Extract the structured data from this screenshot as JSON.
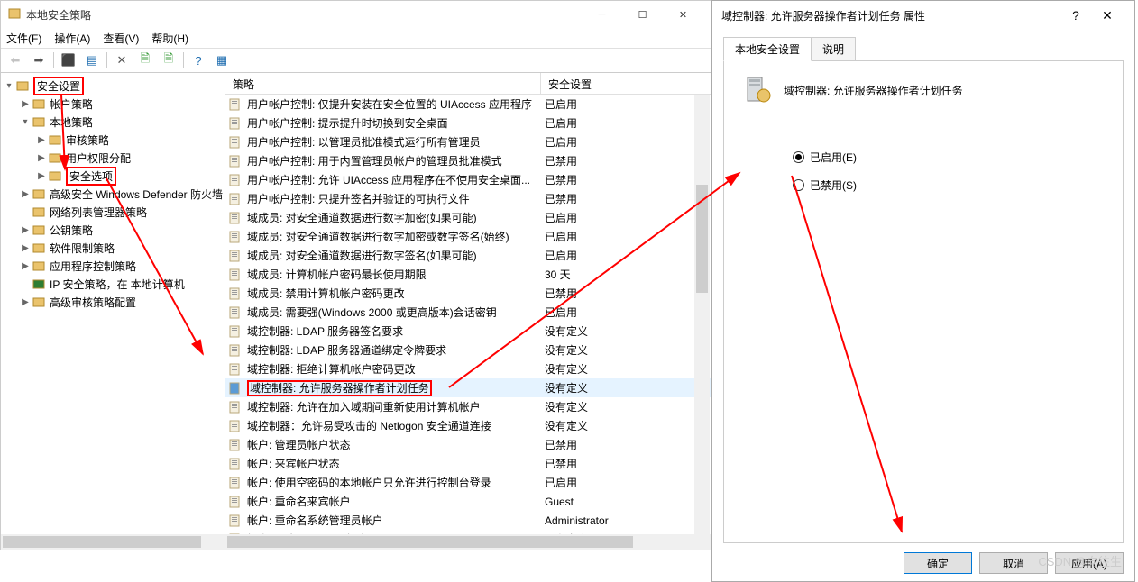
{
  "window": {
    "title": "本地安全策略",
    "menu": {
      "file": "文件(F)",
      "action": "操作(A)",
      "view": "查看(V)",
      "help": "帮助(H)"
    }
  },
  "tree": {
    "root": "安全设置",
    "items": [
      {
        "label": "帐户策略",
        "indent": 1,
        "exp": "▶"
      },
      {
        "label": "本地策略",
        "indent": 1,
        "exp": "▾"
      },
      {
        "label": "审核策略",
        "indent": 2,
        "exp": "▶"
      },
      {
        "label": "用户权限分配",
        "indent": 2,
        "exp": "▶"
      },
      {
        "label": "安全选项",
        "indent": 2,
        "exp": "▶",
        "highlight": true
      },
      {
        "label": "高级安全 Windows Defender 防火墙",
        "indent": 1,
        "exp": "▶"
      },
      {
        "label": "网络列表管理器策略",
        "indent": 1,
        "exp": ""
      },
      {
        "label": "公钥策略",
        "indent": 1,
        "exp": "▶"
      },
      {
        "label": "软件限制策略",
        "indent": 1,
        "exp": "▶"
      },
      {
        "label": "应用程序控制策略",
        "indent": 1,
        "exp": "▶"
      },
      {
        "label": "IP 安全策略，在 本地计算机",
        "indent": 1,
        "exp": "",
        "iconColor": "#2e7d32"
      },
      {
        "label": "高级审核策略配置",
        "indent": 1,
        "exp": "▶"
      }
    ]
  },
  "list": {
    "headers": {
      "policy": "策略",
      "setting": "安全设置"
    },
    "rows": [
      {
        "name": "用户帐户控制: 仅提升安装在安全位置的 UIAccess 应用程序",
        "value": "已启用"
      },
      {
        "name": "用户帐户控制: 提示提升时切换到安全桌面",
        "value": "已启用"
      },
      {
        "name": "用户帐户控制: 以管理员批准模式运行所有管理员",
        "value": "已启用"
      },
      {
        "name": "用户帐户控制: 用于内置管理员帐户的管理员批准模式",
        "value": "已禁用"
      },
      {
        "name": "用户帐户控制: 允许 UIAccess 应用程序在不使用安全桌面...",
        "value": "已禁用"
      },
      {
        "name": "用户帐户控制: 只提升签名并验证的可执行文件",
        "value": "已禁用"
      },
      {
        "name": "域成员: 对安全通道数据进行数字加密(如果可能)",
        "value": "已启用"
      },
      {
        "name": "域成员: 对安全通道数据进行数字加密或数字签名(始终)",
        "value": "已启用"
      },
      {
        "name": "域成员: 对安全通道数据进行数字签名(如果可能)",
        "value": "已启用"
      },
      {
        "name": "域成员: 计算机帐户密码最长使用期限",
        "value": "30 天"
      },
      {
        "name": "域成员: 禁用计算机帐户密码更改",
        "value": "已禁用"
      },
      {
        "name": "域成员: 需要强(Windows 2000 或更高版本)会话密钥",
        "value": "已启用"
      },
      {
        "name": "域控制器: LDAP 服务器签名要求",
        "value": "没有定义"
      },
      {
        "name": "域控制器: LDAP 服务器通道绑定令牌要求",
        "value": "没有定义"
      },
      {
        "name": "域控制器: 拒绝计算机帐户密码更改",
        "value": "没有定义"
      },
      {
        "name": "域控制器: 允许服务器操作者计划任务",
        "value": "没有定义",
        "selected": true,
        "highlight": true
      },
      {
        "name": "域控制器:    允许在加入域期间重新使用计算机帐户",
        "value": "没有定义"
      },
      {
        "name": "域控制器：允许易受攻击的 Netlogon 安全通道连接",
        "value": "没有定义"
      },
      {
        "name": "帐户: 管理员帐户状态",
        "value": "已禁用"
      },
      {
        "name": "帐户: 来宾帐户状态",
        "value": "已禁用"
      },
      {
        "name": "帐户: 使用空密码的本地帐户只允许进行控制台登录",
        "value": "已启用"
      },
      {
        "name": "帐户: 重命名来宾帐户",
        "value": "Guest"
      },
      {
        "name": "帐户: 重命名系统管理员帐户",
        "value": "Administrator"
      },
      {
        "name": "帐户: 阻止 Microsoft 帐户",
        "value": "没有定义"
      }
    ]
  },
  "dialog": {
    "title": "域控制器: 允许服务器操作者计划任务 属性",
    "tab_local": "本地安全设置",
    "tab_explain": "说明",
    "policy_name": "域控制器: 允许服务器操作者计划任务",
    "radio_enabled": "已启用(E)",
    "radio_disabled": "已禁用(S)",
    "btn_ok": "确定",
    "btn_cancel": "取消",
    "btn_apply": "应用(A)"
  },
  "watermark": "CSDN @向往生"
}
